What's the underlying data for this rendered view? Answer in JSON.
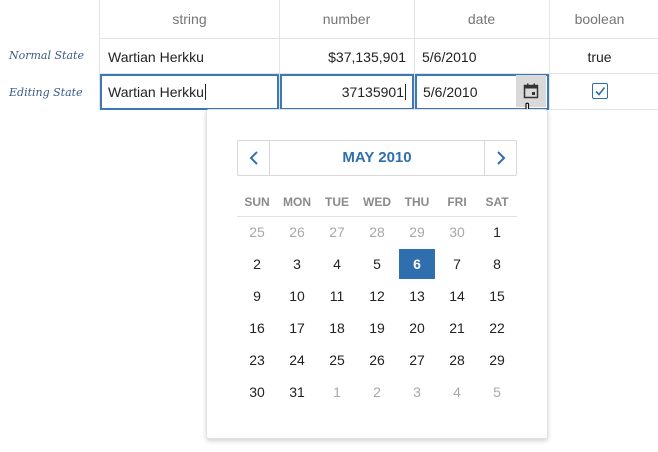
{
  "columns": [
    "string",
    "number",
    "date",
    "boolean"
  ],
  "rows": {
    "normal": {
      "label": "Normal State",
      "string": "Wartian Herkku",
      "number": "$37,135,901",
      "date": "5/6/2010",
      "boolean": "true"
    },
    "editing": {
      "label": "Editing State",
      "string": "Wartian Herkku",
      "number": "37135901",
      "date": "5/6/2010",
      "boolean_checked": true
    }
  },
  "calendar": {
    "month_label": "MAY 2010",
    "prev_icon": "chevron-left-icon",
    "next_icon": "chevron-right-icon",
    "weekdays": [
      "SUN",
      "MON",
      "TUE",
      "WED",
      "THU",
      "FRI",
      "SAT"
    ],
    "selected_day": "6",
    "accent_color": "#2f6fad",
    "weeks": [
      [
        {
          "d": "25",
          "o": true
        },
        {
          "d": "26",
          "o": true
        },
        {
          "d": "27",
          "o": true
        },
        {
          "d": "28",
          "o": true
        },
        {
          "d": "29",
          "o": true
        },
        {
          "d": "30",
          "o": true
        },
        {
          "d": "1",
          "o": false
        }
      ],
      [
        {
          "d": "2",
          "o": false
        },
        {
          "d": "3",
          "o": false
        },
        {
          "d": "4",
          "o": false
        },
        {
          "d": "5",
          "o": false
        },
        {
          "d": "6",
          "o": false
        },
        {
          "d": "7",
          "o": false
        },
        {
          "d": "8",
          "o": false
        }
      ],
      [
        {
          "d": "9",
          "o": false
        },
        {
          "d": "10",
          "o": false
        },
        {
          "d": "11",
          "o": false
        },
        {
          "d": "12",
          "o": false
        },
        {
          "d": "13",
          "o": false
        },
        {
          "d": "14",
          "o": false
        },
        {
          "d": "15",
          "o": false
        }
      ],
      [
        {
          "d": "16",
          "o": false
        },
        {
          "d": "17",
          "o": false
        },
        {
          "d": "18",
          "o": false
        },
        {
          "d": "19",
          "o": false
        },
        {
          "d": "20",
          "o": false
        },
        {
          "d": "21",
          "o": false
        },
        {
          "d": "22",
          "o": false
        }
      ],
      [
        {
          "d": "23",
          "o": false
        },
        {
          "d": "24",
          "o": false
        },
        {
          "d": "25",
          "o": false
        },
        {
          "d": "26",
          "o": false
        },
        {
          "d": "27",
          "o": false
        },
        {
          "d": "28",
          "o": false
        },
        {
          "d": "29",
          "o": false
        }
      ],
      [
        {
          "d": "30",
          "o": false
        },
        {
          "d": "31",
          "o": false
        },
        {
          "d": "1",
          "o": true
        },
        {
          "d": "2",
          "o": true
        },
        {
          "d": "3",
          "o": true
        },
        {
          "d": "4",
          "o": true
        },
        {
          "d": "5",
          "o": true
        }
      ]
    ]
  }
}
